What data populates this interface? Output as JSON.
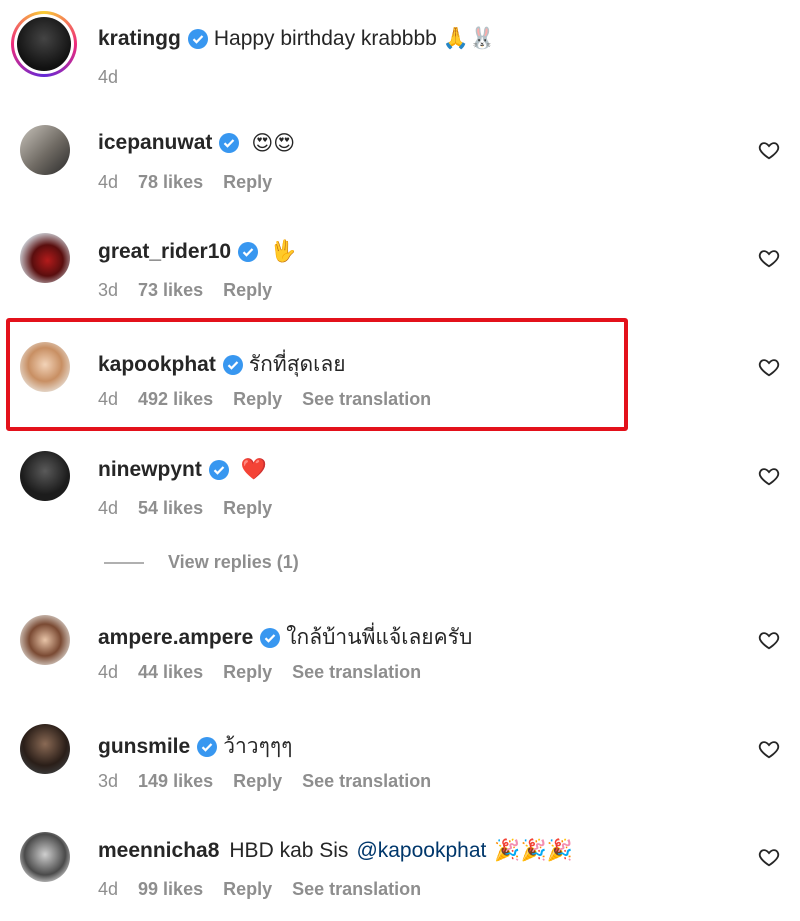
{
  "comments": [
    {
      "username": "kratingg",
      "verified": true,
      "text": "Happy birthday krabbbb",
      "emoji": "🙏🐰",
      "time": "4d",
      "likes": "",
      "reply": "",
      "translation": ""
    },
    {
      "username": "icepanuwat",
      "verified": true,
      "text": "",
      "emoji": "😍😍",
      "time": "4d",
      "likes": "78 likes",
      "reply": "Reply",
      "translation": ""
    },
    {
      "username": "great_rider10",
      "verified": true,
      "text": "",
      "emoji": "🖖",
      "time": "3d",
      "likes": "73 likes",
      "reply": "Reply",
      "translation": ""
    },
    {
      "username": "kapookphat",
      "verified": true,
      "text": "รักที่สุดเลย",
      "emoji": "",
      "time": "4d",
      "likes": "492 likes",
      "reply": "Reply",
      "translation": "See translation"
    },
    {
      "username": "ninewpynt",
      "verified": true,
      "text": "",
      "emoji": "❤️",
      "time": "4d",
      "likes": "54 likes",
      "reply": "Reply",
      "translation": ""
    },
    {
      "username": "ampere.ampere",
      "verified": true,
      "text": "ใกล้บ้านพี่แจ้เลยครับ",
      "emoji": "",
      "time": "4d",
      "likes": "44 likes",
      "reply": "Reply",
      "translation": "See translation"
    },
    {
      "username": "gunsmile",
      "verified": true,
      "text": "ว้าวๆๆๆ",
      "emoji": "",
      "time": "3d",
      "likes": "149 likes",
      "reply": "Reply",
      "translation": "See translation"
    },
    {
      "username": "meennicha8",
      "verified": false,
      "text": "HBD kab Sis",
      "mention": "@kapookphat",
      "emoji": "🎉🎉🎉",
      "time": "4d",
      "likes": "99 likes",
      "reply": "Reply",
      "translation": "See translation"
    }
  ],
  "view_replies": "View replies (1)",
  "colors": {
    "verified": "#3897f0",
    "highlight": "#e3111b",
    "muted": "#8e8e8e",
    "mention": "#00376b"
  }
}
